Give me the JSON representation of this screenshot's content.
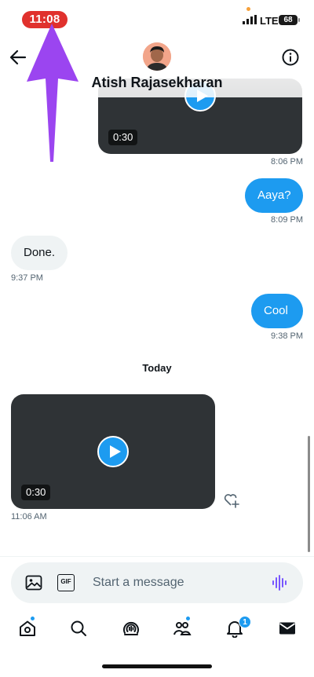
{
  "status_bar": {
    "time": "11:08",
    "network": "LTE",
    "battery": "68"
  },
  "header": {
    "contact_name": "Atish Rajasekharan",
    "back_icon": "arrow-left-icon",
    "info_icon": "info-circle-icon"
  },
  "messages": {
    "video_top": {
      "duration": "0:30",
      "time": "8:06 PM"
    },
    "msg_aaya": {
      "text": "Aaya?",
      "time": "8:09 PM"
    },
    "msg_done": {
      "text": "Done.",
      "time": "9:37 PM"
    },
    "msg_cool": {
      "text": "Cool",
      "time": "9:38 PM"
    },
    "day_separator": "Today",
    "video_today": {
      "duration": "0:30",
      "time": "11:06 AM"
    }
  },
  "composer": {
    "placeholder": "Start a message",
    "gif_label": "GIF"
  },
  "bottom_nav": {
    "items": [
      "home-icon",
      "search-icon",
      "spaces-icon",
      "communities-icon",
      "notifications-icon",
      "messages-icon"
    ],
    "notifications_badge": "1"
  },
  "colors": {
    "accent": "#1d9bf0",
    "time_pill": "#e0312d",
    "annotation_arrow": "#9b45f0",
    "outgoing_bubble": "#1d9bf0",
    "incoming_bubble": "#eff3f4",
    "video_card": "#2f3336"
  }
}
